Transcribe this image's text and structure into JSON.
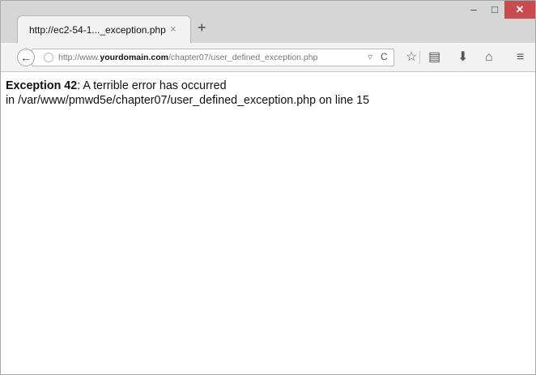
{
  "browser": {
    "tab_title": "http://ec2-54-1..._exception.php",
    "tab_close": "×",
    "new_tab": "+",
    "window_controls": {
      "minimize": "–",
      "maximize": "□",
      "close": "✕"
    },
    "url": {
      "prefix": "http://www.",
      "domain": "yourdomain.com",
      "path": "/chapter07/user_defined_exception.php"
    },
    "icons": [
      "back-icon",
      "globe-icon",
      "dropdown-icon",
      "reload-icon",
      "bookmark-star-icon",
      "reading-list-icon",
      "download-icon",
      "home-icon",
      "menu-icon"
    ]
  },
  "page": {
    "exception_label": "Exception 42",
    "exception_message": ": A terrible error has occurred",
    "location_line": "in /var/www/pmwd5e/chapter07/user_defined_exception.php on line 15"
  }
}
